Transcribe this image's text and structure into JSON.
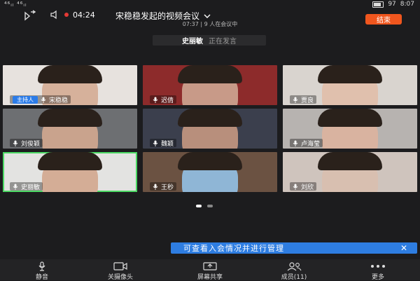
{
  "status_bar": {
    "left_signal": "⁴⁶ᵢₗ ⁴⁶ᵢₗ",
    "battery": "97",
    "time": "8:07",
    "meeting_timer": "04:24"
  },
  "header": {
    "title": "宋稳稳发起的视频会议",
    "meta": "07:37 | 9 人在会议中",
    "end_button": "结束"
  },
  "speaking": {
    "name": "史丽敏",
    "status": "正在发言"
  },
  "participants": [
    {
      "name": "宋稳稳",
      "host_badge": "主持人",
      "face": "#d6b19b",
      "bg": "#e7e2de"
    },
    {
      "name": "迟倩",
      "host_badge": "",
      "face": "#c89a88",
      "bg": "#8d2b2b"
    },
    {
      "name": "贾良",
      "host_badge": "",
      "face": "#e0c0ad",
      "bg": "#d9d4cf"
    },
    {
      "name": "刘俊颖",
      "host_badge": "",
      "face": "#c9a38d",
      "bg": "#6d6f72"
    },
    {
      "name": "魏颖",
      "host_badge": "",
      "face": "#b88f7c",
      "bg": "#3b3f4d"
    },
    {
      "name": "卢海莹",
      "host_badge": "",
      "face": "#d9b3a0",
      "bg": "#b7b3b0"
    },
    {
      "name": "史丽敏",
      "host_badge": "",
      "face": "#d4ad96",
      "bg": "#e3e3e1"
    },
    {
      "name": "王秒",
      "host_badge": "",
      "face": "#8fb6d6",
      "bg": "#6b5242"
    },
    {
      "name": "刘欣",
      "host_badge": "",
      "face": "#d8bfb0",
      "bg": "#cfc4bd"
    }
  ],
  "page_indicator": {
    "current": 1,
    "total": 2
  },
  "tip": {
    "text": "可查看入会情况并进行管理",
    "close": "✕"
  },
  "toolbar": {
    "items": [
      {
        "label": "静音",
        "icon": "mic-icon"
      },
      {
        "label": "关摄像头",
        "icon": "camera-icon"
      },
      {
        "label": "屏幕共享",
        "icon": "screen-share-icon"
      },
      {
        "label": "成员(11)",
        "icon": "members-icon"
      },
      {
        "label": "更多",
        "icon": "more-icon"
      }
    ]
  },
  "colors": {
    "end_button": "#f0561e",
    "accent": "#2e7de1",
    "active_speaker_border": "#4cd964"
  }
}
